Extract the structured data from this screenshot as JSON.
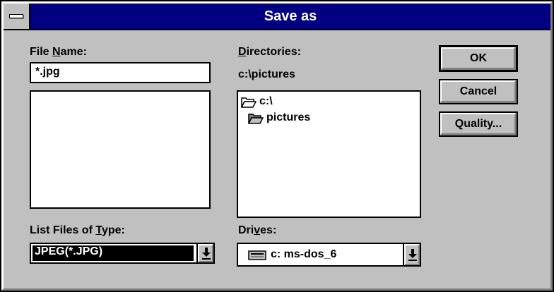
{
  "window": {
    "title": "Save as"
  },
  "file_name": {
    "label_pre": "File ",
    "label_u": "N",
    "label_post": "ame:",
    "value": "*.jpg",
    "files": []
  },
  "directories": {
    "label_u": "D",
    "label_post": "irectories:",
    "current_path": "c:\\pictures",
    "items": [
      {
        "label": "c:\\",
        "icon": "open-folder-icon"
      },
      {
        "label": "pictures",
        "icon": "open-folder-icon"
      }
    ]
  },
  "file_type": {
    "label_pre": "List Files of ",
    "label_u": "T",
    "label_post": "ype:",
    "selected": "JPEG(*.JPG)"
  },
  "drives": {
    "label_pre": "Dri",
    "label_u": "v",
    "label_post": "es:",
    "selected": "c: ms-dos_6",
    "icon": "hard-drive-icon"
  },
  "buttons": {
    "ok": "OK",
    "cancel": "Cancel",
    "quality": "Quality..."
  },
  "colors": {
    "titlebar": "#000080",
    "face": "#c0c0c0",
    "highlight": "#000000"
  }
}
